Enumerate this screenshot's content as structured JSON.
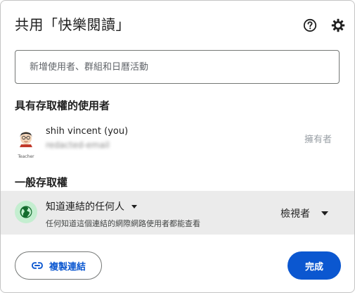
{
  "dialog": {
    "title": "共用「快樂閱讀」",
    "icons": {
      "help": "help-circle-icon",
      "settings": "gear-icon"
    }
  },
  "add_people": {
    "placeholder": "新增使用者、群組和日曆活動",
    "value": ""
  },
  "access_section": {
    "title": "具有存取權的使用者",
    "people": [
      {
        "name": "shih vincent (you)",
        "email": "redacted-email",
        "role": "擁有者",
        "avatar_caption": "Teacher"
      }
    ]
  },
  "general_access": {
    "title": "一般存取權",
    "scope": "知道連結的任何人",
    "description": "任何知道這個連結的網際網路使用者都能查看",
    "role": "檢視者",
    "icon": "globe-icon"
  },
  "footer": {
    "copy_link_label": "複製連結",
    "copy_link_icon": "link-icon",
    "done_label": "完成"
  },
  "colors": {
    "primary": "#0b57d0",
    "general_row_bg": "#ebebeb",
    "globe_bg": "#c4eed0",
    "globe_fg": "#146c2e"
  }
}
